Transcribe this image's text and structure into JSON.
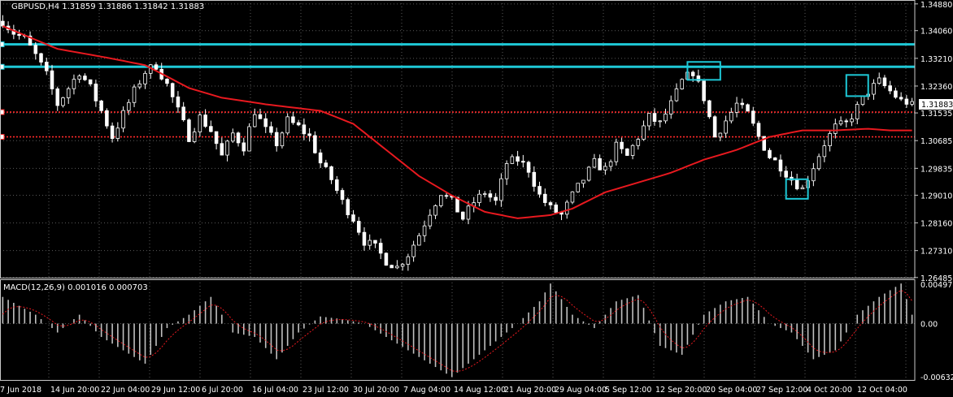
{
  "chart_data": [
    {
      "type": "candlestick",
      "title": "GBPUSD,H4  1.31859 1.31886 1.31842 1.31883",
      "symbol": "GBPUSD",
      "timeframe": "H4",
      "ohlc_last": {
        "open": 1.31859,
        "high": 1.31886,
        "low": 1.31842,
        "close": 1.31883
      },
      "current_price_label": "1.31883",
      "ylim": [
        1.2648,
        1.35
      ],
      "y_ticks": [
        "1.34880",
        "1.34060",
        "1.33210",
        "1.32360",
        "1.31535",
        "1.30685",
        "1.29835",
        "1.29010",
        "1.28160",
        "1.27310",
        "1.26485"
      ],
      "x_ticks": [
        "7 Jun 2018",
        "14 Jun 20:00",
        "22 Jun 04:00",
        "29 Jun 12:00",
        "6 Jul 20:00",
        "16 Jul 04:00",
        "23 Jul 12:00",
        "30 Jul 20:00",
        "7 Aug 04:00",
        "14 Aug 12:00",
        "21 Aug 20:00",
        "29 Aug 04:00",
        "5 Sep 12:00",
        "12 Sep 20:00",
        "20 Sep 04:00",
        "27 Sep 12:00",
        "4 Oct 20:00",
        "12 Oct 04:00"
      ],
      "close_path": [
        [
          0,
          1.3435
        ],
        [
          2,
          1.34
        ],
        [
          4,
          1.338
        ],
        [
          6,
          1.333
        ],
        [
          8,
          1.327
        ],
        [
          10,
          1.318
        ],
        [
          12,
          1.323
        ],
        [
          14,
          1.328
        ],
        [
          16,
          1.323
        ],
        [
          18,
          1.316
        ],
        [
          20,
          1.308
        ],
        [
          22,
          1.315
        ],
        [
          24,
          1.322
        ],
        [
          26,
          1.328
        ],
        [
          28,
          1.33
        ],
        [
          30,
          1.324
        ],
        [
          32,
          1.316
        ],
        [
          34,
          1.308
        ],
        [
          36,
          1.314
        ],
        [
          38,
          1.31
        ],
        [
          40,
          1.302
        ],
        [
          42,
          1.309
        ],
        [
          44,
          1.305
        ],
        [
          46,
          1.316
        ],
        [
          48,
          1.31
        ],
        [
          50,
          1.306
        ],
        [
          52,
          1.313
        ],
        [
          54,
          1.311
        ],
        [
          56,
          1.308
        ],
        [
          58,
          1.3
        ],
        [
          60,
          1.295
        ],
        [
          62,
          1.288
        ],
        [
          64,
          1.283
        ],
        [
          66,
          1.276
        ],
        [
          68,
          1.274
        ],
        [
          70,
          1.27
        ],
        [
          72,
          1.268
        ],
        [
          74,
          1.272
        ],
        [
          76,
          1.278
        ],
        [
          78,
          1.285
        ],
        [
          80,
          1.291
        ],
        [
          82,
          1.288
        ],
        [
          84,
          1.283
        ],
        [
          86,
          1.288
        ],
        [
          88,
          1.291
        ],
        [
          90,
          1.288
        ],
        [
          92,
          1.3
        ],
        [
          94,
          1.301
        ],
        [
          96,
          1.298
        ],
        [
          98,
          1.29
        ],
        [
          100,
          1.286
        ],
        [
          102,
          1.284
        ],
        [
          104,
          1.29
        ],
        [
          106,
          1.295
        ],
        [
          108,
          1.3
        ],
        [
          110,
          1.298
        ],
        [
          112,
          1.305
        ],
        [
          114,
          1.302
        ],
        [
          116,
          1.308
        ],
        [
          118,
          1.314
        ],
        [
          120,
          1.312
        ],
        [
          122,
          1.318
        ],
        [
          124,
          1.325
        ],
        [
          126,
          1.328
        ],
        [
          128,
          1.32
        ],
        [
          130,
          1.308
        ],
        [
          132,
          1.313
        ],
        [
          134,
          1.318
        ],
        [
          136,
          1.315
        ],
        [
          138,
          1.308
        ],
        [
          140,
          1.302
        ],
        [
          142,
          1.299
        ],
        [
          144,
          1.295
        ],
        [
          146,
          1.292
        ],
        [
          148,
          1.299
        ],
        [
          150,
          1.306
        ],
        [
          152,
          1.311
        ],
        [
          154,
          1.312
        ],
        [
          156,
          1.317
        ],
        [
          158,
          1.322
        ],
        [
          160,
          1.325
        ],
        [
          162,
          1.322
        ],
        [
          164,
          1.319
        ],
        [
          166,
          1.3185
        ]
      ],
      "ma_path": [
        [
          0,
          1.342
        ],
        [
          10,
          1.335
        ],
        [
          20,
          1.332
        ],
        [
          26,
          1.33
        ],
        [
          34,
          1.323
        ],
        [
          40,
          1.32
        ],
        [
          48,
          1.318
        ],
        [
          58,
          1.316
        ],
        [
          64,
          1.312
        ],
        [
          70,
          1.304
        ],
        [
          76,
          1.296
        ],
        [
          82,
          1.29
        ],
        [
          88,
          1.285
        ],
        [
          94,
          1.283
        ],
        [
          100,
          1.284
        ],
        [
          104,
          1.286
        ],
        [
          110,
          1.291
        ],
        [
          116,
          1.294
        ],
        [
          122,
          1.297
        ],
        [
          128,
          1.301
        ],
        [
          134,
          1.304
        ],
        [
          140,
          1.308
        ],
        [
          146,
          1.31
        ],
        [
          152,
          1.31
        ],
        [
          158,
          1.3105
        ],
        [
          162,
          1.31
        ],
        [
          166,
          1.31
        ]
      ],
      "horizontal_levels": [
        {
          "price": 1.3364,
          "color": "#1ec8d6",
          "style": "solid"
        },
        {
          "price": 1.3295,
          "color": "#1ec8d6",
          "style": "solid"
        },
        {
          "price": 1.3156,
          "color": "#ff2a2a",
          "style": "dotted"
        },
        {
          "price": 1.308,
          "color": "#ff2a2a",
          "style": "dotted"
        }
      ],
      "highlight_boxes": [
        {
          "from_bar": 125,
          "to_bar": 131,
          "price_high": 1.331,
          "price_low": 1.3255
        },
        {
          "from_bar": 143,
          "to_bar": 147,
          "price_high": 1.295,
          "price_low": 1.289
        },
        {
          "from_bar": 154,
          "to_bar": 158,
          "price_high": 1.327,
          "price_low": 1.3205
        }
      ],
      "colors": {
        "candle": "#ffffff",
        "ma": "#e8191f",
        "levels": "#1ec8d6",
        "support": "#ff2a2a",
        "grid": "#5a5a5a"
      }
    },
    {
      "type": "histogram",
      "title": "MACD(12,26,9) 0.001016 0.000703",
      "indicator": "MACD",
      "parameters": [
        12,
        26,
        9
      ],
      "macd_value": "0.001016",
      "signal_value": "0.000703",
      "ylim": [
        -0.006329,
        0.004977
      ],
      "y_ticks": [
        "0.004977",
        "0.00",
        "-0.006329"
      ],
      "histogram_path": [
        [
          0,
          0.003
        ],
        [
          6,
          0.001
        ],
        [
          10,
          -0.001
        ],
        [
          14,
          0.001
        ],
        [
          18,
          -0.0015
        ],
        [
          22,
          -0.003
        ],
        [
          26,
          -0.0045
        ],
        [
          30,
          -0.0005
        ],
        [
          34,
          0.001
        ],
        [
          38,
          0.003
        ],
        [
          42,
          -0.001
        ],
        [
          46,
          -0.0015
        ],
        [
          50,
          -0.004
        ],
        [
          54,
          -0.001
        ],
        [
          58,
          0.0008
        ],
        [
          62,
          0.0005
        ],
        [
          66,
          0.0
        ],
        [
          70,
          -0.0015
        ],
        [
          74,
          -0.003
        ],
        [
          78,
          -0.0045
        ],
        [
          82,
          -0.006
        ],
        [
          86,
          -0.004
        ],
        [
          90,
          -0.002
        ],
        [
          94,
          0.0
        ],
        [
          98,
          0.0025
        ],
        [
          100,
          0.0045
        ],
        [
          104,
          0.001
        ],
        [
          108,
          -0.0005
        ],
        [
          112,
          0.0025
        ],
        [
          116,
          0.0032
        ],
        [
          120,
          -0.0025
        ],
        [
          124,
          -0.0035
        ],
        [
          128,
          0.001
        ],
        [
          132,
          0.0025
        ],
        [
          136,
          0.003
        ],
        [
          140,
          0.0
        ],
        [
          144,
          -0.001
        ],
        [
          148,
          -0.004
        ],
        [
          152,
          -0.003
        ],
        [
          156,
          0.001
        ],
        [
          160,
          0.003
        ],
        [
          164,
          0.0045
        ],
        [
          166,
          0.001
        ]
      ],
      "colors": {
        "histogram": "#c0c0c0",
        "signal": "#e8191f"
      }
    }
  ]
}
